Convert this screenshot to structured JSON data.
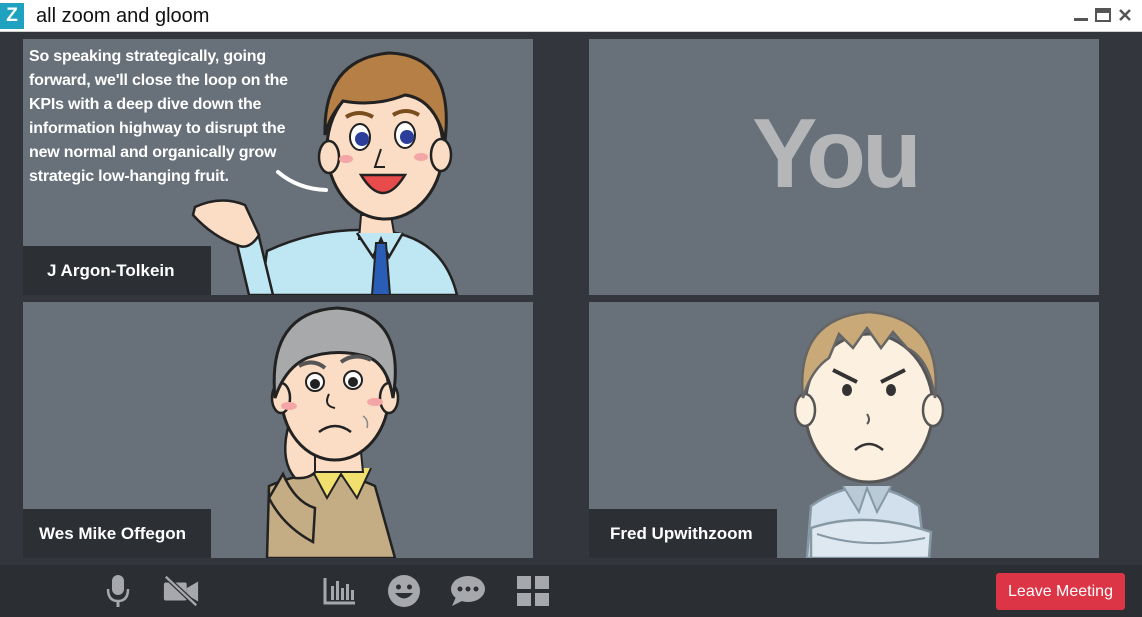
{
  "window": {
    "app_logo": "Z",
    "title": "all zoom and gloom",
    "controls": [
      "minimize-icon",
      "maximize-icon",
      "close-icon"
    ]
  },
  "participants": [
    {
      "name": "J Argon-Tolkein",
      "caption": "So speaking strategically, going forward, we'll close the loop on the KPIs with a deep dive down the information highway to disrupt the new normal and organically grow strategic low-hanging fruit.",
      "avatar": "talking-businessman"
    },
    {
      "label": "You"
    },
    {
      "name": "Wes Mike Offegon",
      "avatar": "worried-older-man"
    },
    {
      "name": "Fred Upwithzoom",
      "avatar": "angry-man-arms-crossed"
    }
  ],
  "toolbar": {
    "icons": [
      "microphone-icon",
      "camera-off-icon",
      "stats-icon",
      "emoji-icon",
      "chat-icon",
      "grid-view-icon"
    ],
    "leave_label": "Leave Meeting"
  },
  "colors": {
    "tile_bg": "#687079",
    "stage_bg": "#33373d",
    "toolbar_bg": "#2b2e33",
    "leave_button": "#dc3545",
    "logo": "#1ea2c0"
  }
}
